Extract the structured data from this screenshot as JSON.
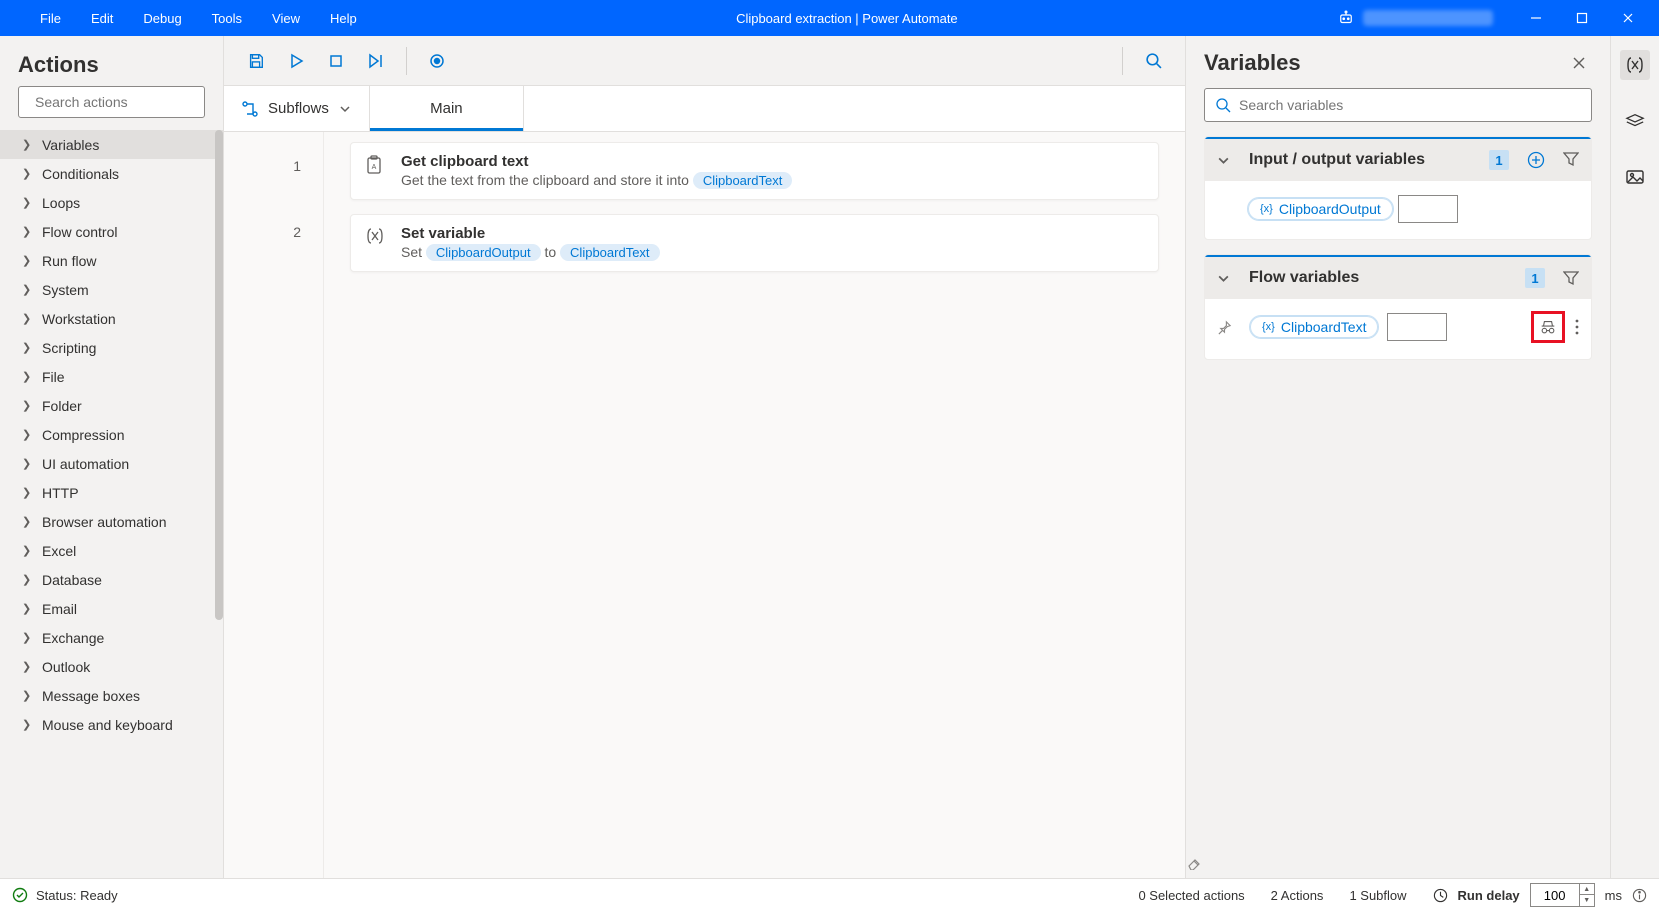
{
  "menu": {
    "file": "File",
    "edit": "Edit",
    "debug": "Debug",
    "tools": "Tools",
    "view": "View",
    "help": "Help"
  },
  "window": {
    "title": "Clipboard extraction | Power Automate"
  },
  "actions": {
    "title": "Actions",
    "search_placeholder": "Search actions",
    "categories": [
      "Variables",
      "Conditionals",
      "Loops",
      "Flow control",
      "Run flow",
      "System",
      "Workstation",
      "Scripting",
      "File",
      "Folder",
      "Compression",
      "UI automation",
      "HTTP",
      "Browser automation",
      "Excel",
      "Database",
      "Email",
      "Exchange",
      "Outlook",
      "Message boxes",
      "Mouse and keyboard"
    ]
  },
  "workspace": {
    "subflows_label": "Subflows",
    "tab_main": "Main",
    "steps": [
      {
        "num": "1",
        "title": "Get clipboard text",
        "pre": "Get the text from the clipboard and store it into ",
        "chip1": "ClipboardText"
      },
      {
        "num": "2",
        "title": "Set variable",
        "pre": "Set ",
        "chip1": "ClipboardOutput",
        "mid": " to ",
        "chip2": "ClipboardText"
      }
    ]
  },
  "variables": {
    "title": "Variables",
    "search_placeholder": "Search variables",
    "io_group": {
      "title": "Input / output variables",
      "count": "1",
      "var": "ClipboardOutput"
    },
    "flow_group": {
      "title": "Flow variables",
      "count": "1",
      "var": "ClipboardText"
    }
  },
  "status": {
    "ready": "Status: Ready",
    "selected": "0 Selected actions",
    "actions": "2 Actions",
    "subflows": "1 Subflow",
    "run_delay": "Run delay",
    "delay_value": "100",
    "ms": "ms"
  }
}
